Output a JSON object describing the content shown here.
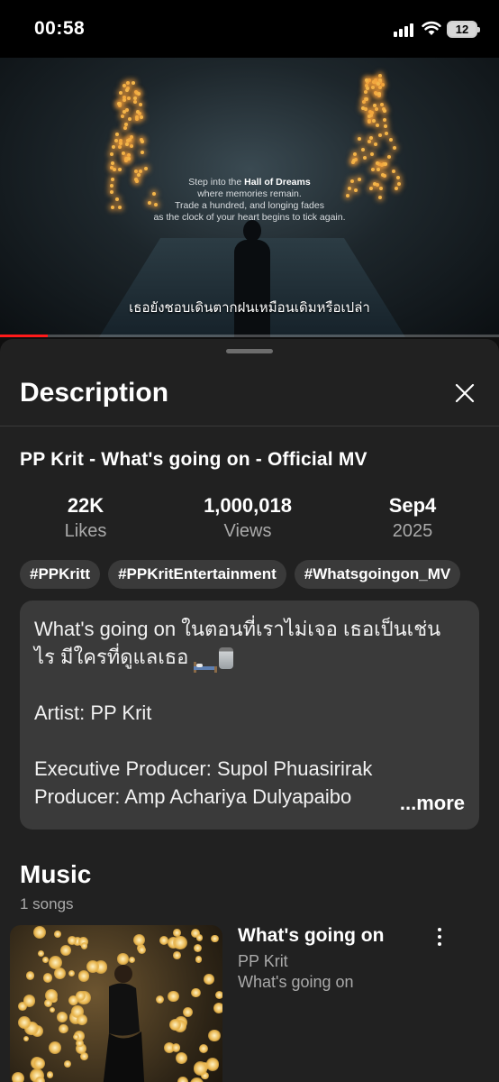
{
  "status_bar": {
    "time": "00:58",
    "battery": "12",
    "icons": [
      "signal-icon",
      "wifi-icon",
      "battery-icon"
    ]
  },
  "video": {
    "overlay_line1_prefix": "Step into the ",
    "overlay_line1_bold": "Hall of Dreams",
    "overlay_line2": "where memories remain.",
    "overlay_line3": "Trade a hundred, and longing fades",
    "overlay_line4": "as the clock of your heart begins to tick again.",
    "subtitle": "เธอยังชอบเดินตากฝนเหมือนเดิมหรือเปล่า",
    "progress_fraction": 0.095,
    "progress_color": "#ff1a1a"
  },
  "sheet": {
    "title": "Description",
    "video_title": "PP Krit - What's going on - Official MV",
    "stats": [
      {
        "value": "22K",
        "label": "Likes"
      },
      {
        "value": "1,000,018",
        "label": "Views"
      },
      {
        "value": "Sep4",
        "label": "2025"
      }
    ],
    "tags": [
      "#PPKritt",
      "#PPKritEntertainment",
      "#Whatsgoingon_MV"
    ],
    "description": {
      "line1": "What's going on ในตอนที่เราไม่เจอ เธอเป็นเช่น",
      "line2": "ไร มีใครที่ดูแลเธอ",
      "line3": "Artist: PP Krit",
      "line4": "Executive Producer: Supol Phuasirirak",
      "line5": "Producer: Amp Achariya Dulyapaibo",
      "more": "...more",
      "emojis": [
        "bed-icon",
        "jar-icon"
      ]
    }
  },
  "music": {
    "section_title": "Music",
    "count": "1 songs",
    "item": {
      "title": "What's going on",
      "artist": "PP Krit",
      "album": "What's going on"
    }
  }
}
